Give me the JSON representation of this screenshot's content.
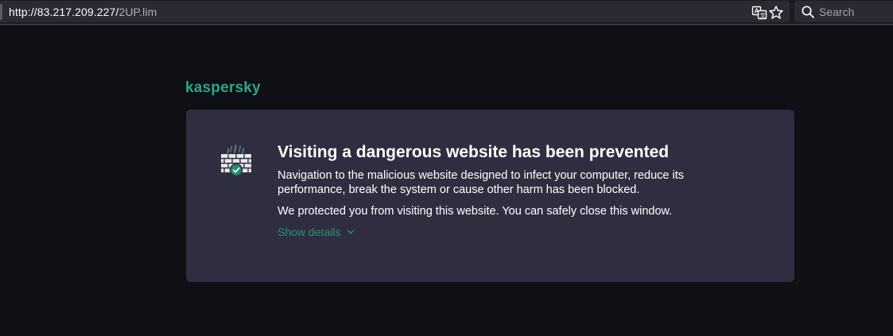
{
  "browser": {
    "url_host": "http://83.217.209.227/",
    "url_path": "2UP.lim",
    "search_placeholder": "Search",
    "icons": [
      "translate-icon",
      "bookmark-star-icon",
      "search-icon"
    ]
  },
  "page": {
    "brand": "kaspersky",
    "heading": "Visiting a dangerous website has been prevented",
    "description": "Navigation to the malicious website designed to infect your computer, reduce its performance, break the system or cause other harm has been blocked.",
    "reassurance": "We protected you from visiting this website. You can safely close this window.",
    "details_label": "Show details"
  },
  "colors": {
    "page_bg": "#0f0f16",
    "card_bg": "#2f2e40",
    "brand_green": "#29a986",
    "link_green": "#2a8f73"
  }
}
